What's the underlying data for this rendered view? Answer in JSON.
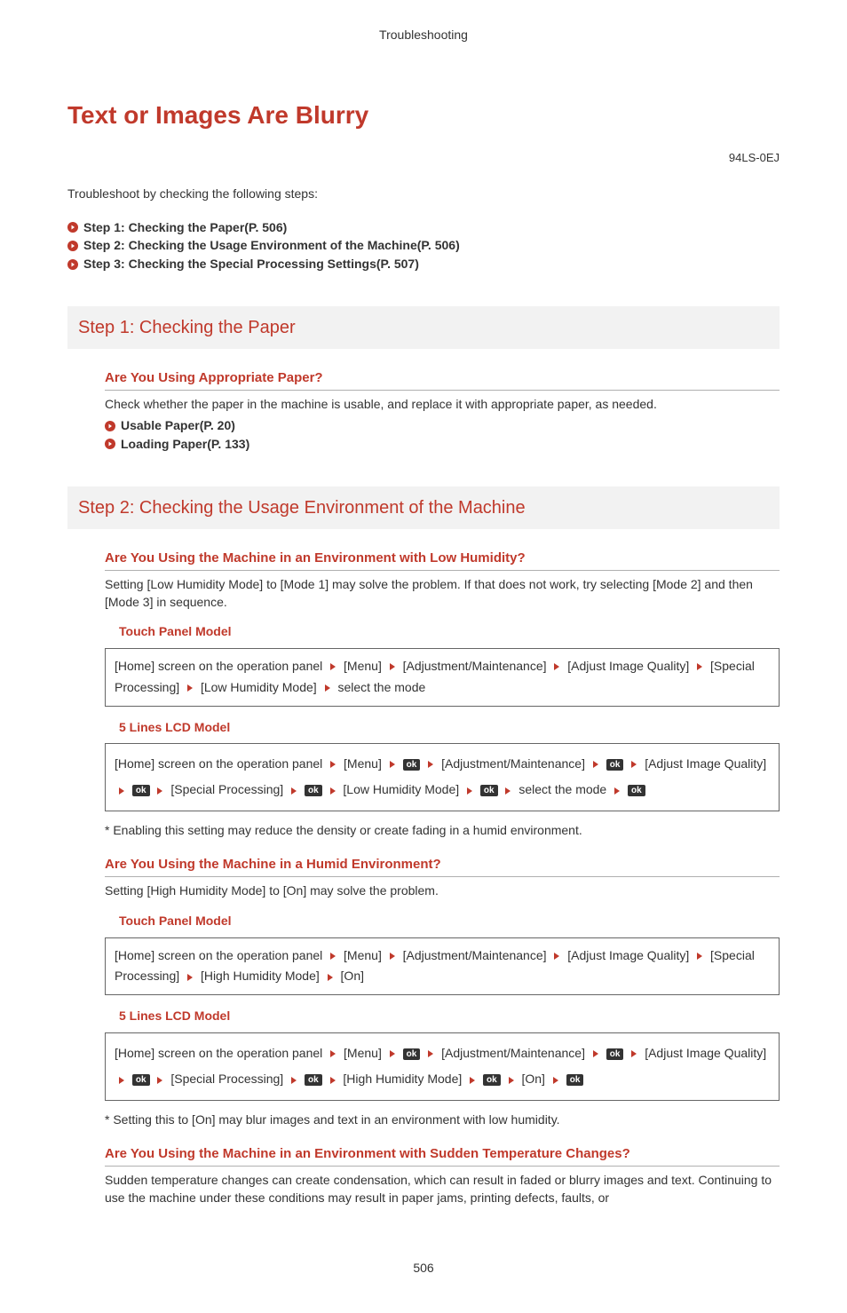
{
  "header_category": "Troubleshooting",
  "page_title": "Text or Images Are Blurry",
  "doc_code": "94LS-0EJ",
  "intro": "Troubleshoot by checking the following steps:",
  "step_links": [
    "Step 1: Checking the Paper(P. 506)",
    "Step 2: Checking the Usage Environment of the Machine(P. 506)",
    "Step 3: Checking the Special Processing Settings(P. 507)"
  ],
  "step1": {
    "heading": "Step 1: Checking the Paper",
    "sub": "Are You Using Appropriate Paper?",
    "body": "Check whether the paper in the machine is usable, and replace it with appropriate paper, as needed.",
    "refs": [
      "Usable Paper(P. 20)",
      "Loading Paper(P. 133)"
    ]
  },
  "step2": {
    "heading": "Step 2: Checking the Usage Environment of the Machine",
    "low_humidity": {
      "sub": "Are You Using the Machine in an Environment with Low Humidity?",
      "body": "Setting [Low Humidity Mode] to [Mode 1] may solve the problem. If that does not work, try selecting [Mode 2] and then [Mode 3] in sequence.",
      "touch_label": "Touch Panel Model",
      "touch_path": [
        "[Home] screen on the operation panel",
        "[Menu]",
        "[Adjustment/Maintenance]",
        "[Adjust Image Quality]",
        "[Special Processing]",
        "[Low Humidity Mode]",
        "select the mode"
      ],
      "lcd_label": "5 Lines LCD Model",
      "lcd_path": [
        "[Home] screen on the operation panel",
        "[Menu]",
        "OK",
        "[Adjustment/Maintenance]",
        "OK",
        "[Adjust Image Quality]",
        "OK",
        "[Special Processing]",
        "OK",
        "[Low Humidity Mode]",
        "OK",
        "select the mode",
        "OK"
      ],
      "note": "* Enabling this setting may reduce the density or create fading in a humid environment."
    },
    "humid": {
      "sub": "Are You Using the Machine in a Humid Environment?",
      "body": "Setting [High Humidity Mode] to [On] may solve the problem.",
      "touch_label": "Touch Panel Model",
      "touch_path": [
        "[Home] screen on the operation panel",
        "[Menu]",
        "[Adjustment/Maintenance]",
        "[Adjust Image Quality]",
        "[Special Processing]",
        "[High Humidity Mode]",
        "[On]"
      ],
      "lcd_label": "5 Lines LCD Model",
      "lcd_path": [
        "[Home] screen on the operation panel",
        "[Menu]",
        "OK",
        "[Adjustment/Maintenance]",
        "OK",
        "[Adjust Image Quality]",
        "OK",
        "[Special Processing]",
        "OK",
        "[High Humidity Mode]",
        "OK",
        "[On]",
        "OK"
      ],
      "note": "* Setting this to [On] may blur images and text in an environment with low humidity."
    },
    "temp": {
      "sub": "Are You Using the Machine in an Environment with Sudden Temperature Changes?",
      "body": "Sudden temperature changes can create condensation, which can result in faded or blurry images and text. Continuing to use the machine under these conditions may result in paper jams, printing defects, faults, or"
    }
  },
  "page_number": "506",
  "ok_text": "ok"
}
